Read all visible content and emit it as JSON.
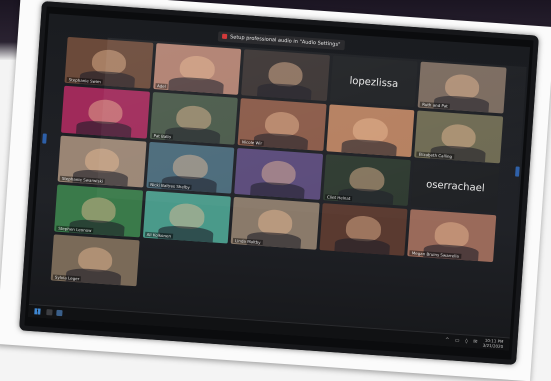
{
  "zoom": {
    "notice_text": "Setup professional audio in \"Audio Settings\"",
    "tiles": [
      {
        "label": "Stephanie Swim",
        "big": "",
        "bg": "#6b4a3a"
      },
      {
        "label": "Adel",
        "big": "",
        "bg": "#b08070"
      },
      {
        "label": "",
        "big": "",
        "bg": "#3b3433"
      },
      {
        "label": "",
        "big": "lopezlissa",
        "bg": "#1f2124"
      },
      {
        "label": "Ruth and Pat",
        "big": "",
        "bg": "#7a6a5e"
      },
      {
        "label": "",
        "big": "",
        "bg": "#a02a5a"
      },
      {
        "label": "Pat Ballo",
        "big": "",
        "bg": "#4a5a4a"
      },
      {
        "label": "Nicole Wir",
        "big": "",
        "bg": "#8a5a48"
      },
      {
        "label": "",
        "big": "",
        "bg": "#b57f5f"
      },
      {
        "label": "Elizabeth Calling",
        "big": "",
        "bg": "#6e6a52"
      },
      {
        "label": "Stephanie Swarwiski",
        "big": "",
        "bg": "#9a8574"
      },
      {
        "label": "Nicki Baltres Shelby",
        "big": "",
        "bg": "#4a6a7a"
      },
      {
        "label": "",
        "big": "",
        "bg": "#5a4a7a"
      },
      {
        "label": "Clint Helnat",
        "big": "",
        "bg": "#2e3a30"
      },
      {
        "label": "",
        "big": "oserrachael",
        "bg": "#1f2124"
      },
      {
        "label": "Stephen Leonow",
        "big": "",
        "bg": "#3a7a4a"
      },
      {
        "label": "Ali Kolkonen",
        "big": "",
        "bg": "#4a9a8a"
      },
      {
        "label": "Linda Maltby",
        "big": "",
        "bg": "#8a7a6a"
      },
      {
        "label": "",
        "big": "",
        "bg": "#5a3a30"
      },
      {
        "label": "Megan Bruins Swarrella",
        "big": "",
        "bg": "#9a6a5a"
      },
      {
        "label": "Sylvia Leger",
        "big": "",
        "bg": "#7a6a58"
      }
    ],
    "clock_time": "10:11 PM",
    "clock_date": "3/21/2020"
  }
}
